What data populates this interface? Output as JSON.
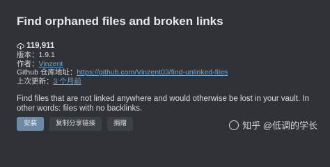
{
  "plugin": {
    "title": "Find orphaned files and broken links",
    "downloads": "119,911",
    "version_label": "版本：",
    "version": "1.9.1",
    "author_label": "作者：",
    "author": "Vinzent",
    "repo_label": "Github 仓库地址：",
    "repo_url": "https://github.com/Vinzent03/find-unlinked-files",
    "updated_label": "上次更新：",
    "updated": "3 个月前",
    "description": "Find files that are not linked anywhere and would otherwise be lost in your vault. In other words: files with no backlinks."
  },
  "actions": {
    "install": "安装",
    "copy_share_link": "复制分享链接",
    "donate": "捐赠"
  },
  "watermark": {
    "text": "知乎 @低调的学长"
  },
  "icons": {
    "downloads": "download-cloud-icon",
    "watermark": "zhihu-logo-icon"
  }
}
